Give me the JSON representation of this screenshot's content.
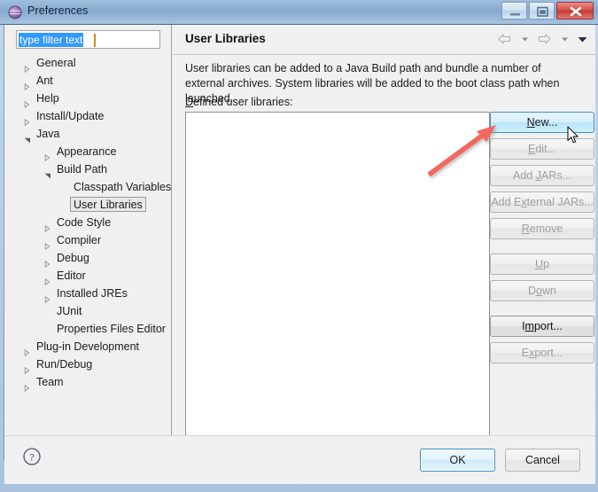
{
  "window": {
    "title": "Preferences",
    "icon": "eclipse-sphere-icon",
    "controls": {
      "minimize": "minimize-icon",
      "maximize": "maximize-icon",
      "close": "close-icon"
    }
  },
  "filter": {
    "value": "type filter text",
    "placeholder": "type filter text"
  },
  "tree": {
    "items": [
      {
        "label": "General",
        "level": 1,
        "state": "collapsed",
        "selected": false
      },
      {
        "label": "Ant",
        "level": 1,
        "state": "collapsed",
        "selected": false
      },
      {
        "label": "Help",
        "level": 1,
        "state": "collapsed",
        "selected": false
      },
      {
        "label": "Install/Update",
        "level": 1,
        "state": "collapsed",
        "selected": false
      },
      {
        "label": "Java",
        "level": 1,
        "state": "expanded",
        "selected": false
      },
      {
        "label": "Appearance",
        "level": 2,
        "state": "collapsed",
        "selected": false
      },
      {
        "label": "Build Path",
        "level": 2,
        "state": "expanded",
        "selected": false
      },
      {
        "label": "Classpath Variables",
        "level": 3,
        "state": "leaf",
        "selected": false
      },
      {
        "label": "User Libraries",
        "level": 3,
        "state": "leaf",
        "selected": true
      },
      {
        "label": "Code Style",
        "level": 2,
        "state": "collapsed",
        "selected": false
      },
      {
        "label": "Compiler",
        "level": 2,
        "state": "collapsed",
        "selected": false
      },
      {
        "label": "Debug",
        "level": 2,
        "state": "collapsed",
        "selected": false
      },
      {
        "label": "Editor",
        "level": 2,
        "state": "collapsed",
        "selected": false
      },
      {
        "label": "Installed JREs",
        "level": 2,
        "state": "collapsed",
        "selected": false
      },
      {
        "label": "JUnit",
        "level": 2,
        "state": "leaf",
        "selected": false
      },
      {
        "label": "Properties Files Editor",
        "level": 2,
        "state": "leaf",
        "selected": false
      },
      {
        "label": "Plug-in Development",
        "level": 1,
        "state": "collapsed",
        "selected": false
      },
      {
        "label": "Run/Debug",
        "level": 1,
        "state": "collapsed",
        "selected": false
      },
      {
        "label": "Team",
        "level": 1,
        "state": "collapsed",
        "selected": false
      }
    ]
  },
  "pane": {
    "title": "User Libraries",
    "description": "User libraries can be added to a Java Build path and bundle a number of external archives. System libraries will be added to the boot class path when launched.",
    "list_label_mnemonic": "D",
    "list_label_rest": "efined user libraries:",
    "nav": [
      {
        "name": "back-arrow-icon",
        "kind": "arrow-left"
      },
      {
        "name": "back-dropdown-icon",
        "kind": "caret"
      },
      {
        "name": "forward-arrow-icon",
        "kind": "arrow-right"
      },
      {
        "name": "forward-dropdown-icon",
        "kind": "caret"
      },
      {
        "name": "view-menu-icon",
        "kind": "caret-dark"
      }
    ],
    "list_items": []
  },
  "buttons": [
    {
      "name": "new-button",
      "mnemonic": "N",
      "pre": "",
      "post": "ew...",
      "state": "hover"
    },
    {
      "name": "edit-button",
      "mnemonic": "E",
      "pre": "",
      "post": "dit...",
      "state": "disabled"
    },
    {
      "name": "add-jars-button",
      "mnemonic": "J",
      "pre": "Add ",
      "post": "ARs...",
      "state": "disabled"
    },
    {
      "name": "add-external-jars-button",
      "mnemonic": "x",
      "pre": "Add E",
      "post": "ternal JARs...",
      "state": "disabled"
    },
    {
      "name": "remove-button",
      "mnemonic": "R",
      "pre": "",
      "post": "emove",
      "state": "disabled"
    },
    {
      "name": "up-button",
      "mnemonic": "U",
      "pre": "",
      "post": "p",
      "state": "disabled"
    },
    {
      "name": "down-button",
      "mnemonic": "o",
      "pre": "D",
      "post": "wn",
      "state": "disabled"
    },
    {
      "name": "import-button",
      "mnemonic": "m",
      "pre": "I",
      "post": "port...",
      "state": "enabled"
    },
    {
      "name": "export-button",
      "mnemonic": "x",
      "pre": "E",
      "post": "port...",
      "state": "disabled"
    }
  ],
  "footer": {
    "help": "help-icon",
    "ok": "OK",
    "cancel": "Cancel"
  },
  "annotation": {
    "type": "arrow",
    "color": "#f2685e",
    "points_to": "new-button"
  },
  "colors": {
    "title_bar": "#86a9cd",
    "accent_blue": "#3399ff",
    "focus_blue": "#3c8fcb",
    "panel_bg": "#f0f0f0",
    "annotation_red": "#f2685e",
    "close_red": "#c53a32",
    "eclipse_purple": "#8e6aa8"
  }
}
